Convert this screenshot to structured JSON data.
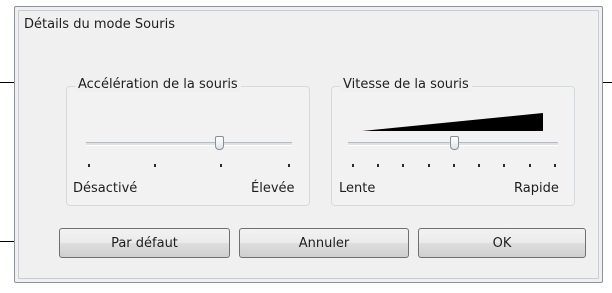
{
  "dialog": {
    "title": "Détails du mode Souris"
  },
  "acceleration": {
    "title": "Accélération de la souris",
    "min_label": "Désactivé",
    "max_label": "Élevée",
    "ticks": 4,
    "value_fraction": 0.67
  },
  "speed": {
    "title": "Vitesse de la souris",
    "min_label": "Lente",
    "max_label": "Rapide",
    "ticks": 9,
    "value_fraction": 0.5
  },
  "buttons": {
    "default_label": "Par défaut",
    "cancel_label": "Annuler",
    "ok_label": "OK"
  }
}
